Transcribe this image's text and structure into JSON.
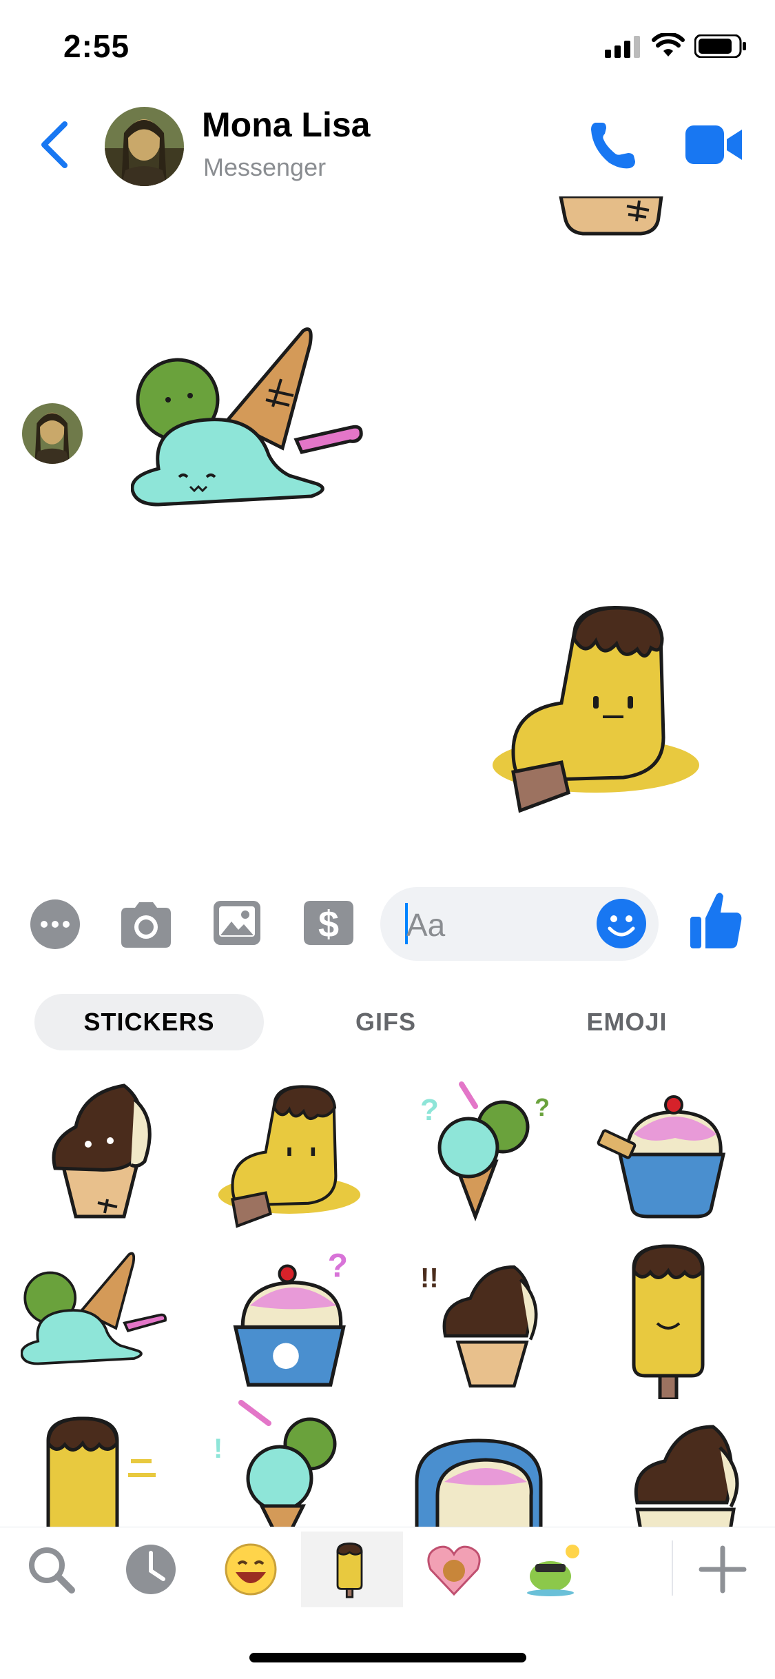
{
  "status_bar": {
    "time": "2:55",
    "battery_level": 0.85
  },
  "header": {
    "contact_name": "Mona Lisa",
    "subtitle": "Messenger",
    "icons": [
      "back-chevron-icon",
      "phone-icon",
      "video-camera-icon"
    ],
    "accent_color": "#1877f2"
  },
  "chat": {
    "messages": [
      {
        "from": "contact",
        "type": "sticker",
        "sticker": "melted-ice-cream-cone"
      },
      {
        "from": "me",
        "type": "sticker",
        "sticker": "melted-popsicle-bar"
      }
    ]
  },
  "composer": {
    "placeholder": "Aa",
    "tools": [
      "more-icon",
      "camera-icon",
      "gallery-icon",
      "payment-icon"
    ],
    "emoji_icon": "smiley-icon",
    "send_icon": "thumbs-up-icon"
  },
  "tray": {
    "tabs": [
      {
        "label": "STICKERS",
        "selected": true
      },
      {
        "label": "GIFS",
        "selected": false
      },
      {
        "label": "EMOJI",
        "selected": false
      }
    ],
    "stickers": [
      "soft-serve-wave",
      "melted-popsicle",
      "confused-scoops",
      "sundae-cup",
      "melted-cone",
      "sundae-question",
      "surprised-soft-serve",
      "happy-popsicle",
      "running-popsicle",
      "surprised-scoops",
      "crying-sundae",
      "soft-serve-top"
    ],
    "packs": [
      "search-icon",
      "recent-clock-icon",
      "laughing-face-pack",
      "popsicle-pack",
      "heart-creature-pack",
      "frog-sun-pack",
      "add-pack-icon"
    ]
  }
}
